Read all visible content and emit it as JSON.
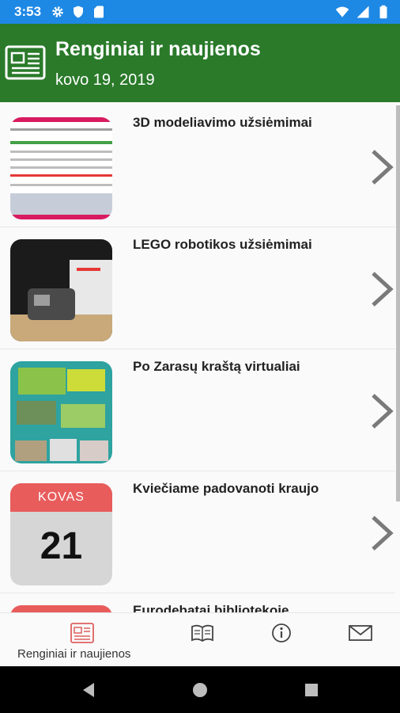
{
  "status_bar": {
    "time": "3:53",
    "icons": [
      "gear-icon",
      "shield-icon",
      "sd-card-icon",
      "wifi-icon",
      "signal-icon",
      "battery-icon"
    ],
    "color": "#1e88e5"
  },
  "header": {
    "title": "Renginiai ir naujienos",
    "date": "kovo 19, 2019",
    "icon": "newspaper-icon",
    "color": "#2a7a2a"
  },
  "items": [
    {
      "title": "3D modeliavimo užsiėmimai",
      "thumb": "event-poster"
    },
    {
      "title": "LEGO robotikos užsiėmimai",
      "thumb": "lego-robot-photo"
    },
    {
      "title": "Po Zarasų kraštą virtualiai",
      "thumb": "map-collage"
    },
    {
      "title": "Kviečiame padovanoti kraujo",
      "thumb": "calendar",
      "calendar": {
        "month": "KOVAS",
        "day": "21"
      }
    },
    {
      "title": "Eurodebatai bibliotekoje",
      "thumb": "calendar",
      "calendar": {
        "month": "",
        "day": ""
      }
    }
  ],
  "bottom_nav": [
    {
      "label": "Renginiai ir naujienos",
      "icon": "newspaper-icon",
      "active": true
    },
    {
      "label": "",
      "icon": "book-icon",
      "active": false
    },
    {
      "label": "",
      "icon": "info-icon",
      "active": false
    },
    {
      "label": "",
      "icon": "envelope-icon",
      "active": false
    }
  ],
  "colors": {
    "accent": "#2a7a2a",
    "active_nav": "#e06060",
    "calendar_red": "#e85c5c"
  }
}
